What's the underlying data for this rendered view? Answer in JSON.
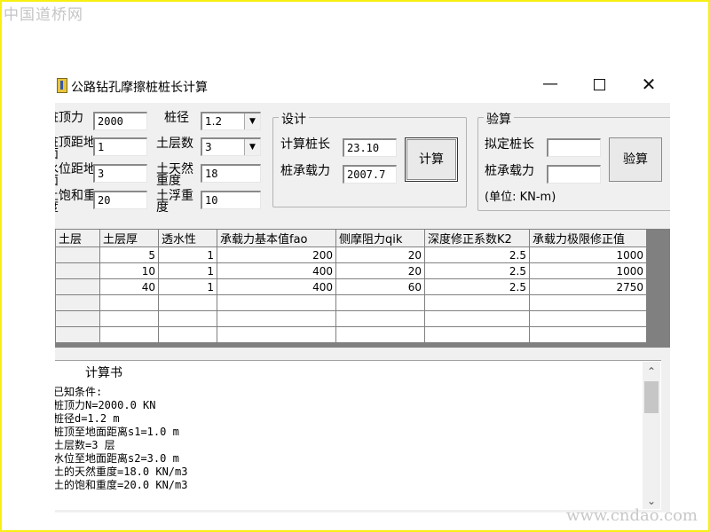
{
  "watermark_top": "中国道桥网",
  "watermark_bottom": "www.cndao.com",
  "window": {
    "title": "公路钻孔摩擦桩桩长计算",
    "minimize": "—",
    "close": "✕"
  },
  "inputs": {
    "pile_top_force_label": "桩顶力",
    "pile_top_force_value": "2000",
    "pile_top_distance_label": "桩顶距地面",
    "pile_top_distance_value": "1",
    "water_distance_label": "水位距地面",
    "water_distance_value": "3",
    "saturated_weight_label": "土饱和重度",
    "saturated_weight_value": "20",
    "diameter_label": "桩径",
    "diameter_value": "1.2",
    "layers_label": "土层数",
    "layers_value": "3",
    "natural_weight_label": "土天然重度",
    "natural_weight_value": "18",
    "buoyant_weight_label": "土浮重度",
    "buoyant_weight_value": "10"
  },
  "design": {
    "title": "设计",
    "calc_length_label": "计算桩长",
    "calc_length_value": "23.10",
    "capacity_label": "桩承载力",
    "capacity_value": "2007.7",
    "calc_button": "计算"
  },
  "check": {
    "title": "验算",
    "proposed_length_label": "拟定桩长",
    "proposed_length_value": "",
    "capacity_label": "桩承载力",
    "capacity_value": "",
    "unit_text": "(单位: KN-m)",
    "check_button": "验算"
  },
  "grid": {
    "columns": [
      "土层",
      "土层厚",
      "透水性",
      "承载力基本值fao",
      "侧摩阻力qik",
      "深度修正系数K2",
      "承载力极限修正值"
    ],
    "rows": [
      [
        "",
        "5",
        "1",
        "200",
        "20",
        "2.5",
        "1000"
      ],
      [
        "",
        "10",
        "1",
        "400",
        "20",
        "2.5",
        "1000"
      ],
      [
        "",
        "40",
        "1",
        "400",
        "60",
        "2.5",
        "2750"
      ],
      [
        "",
        "",
        "",
        "",
        "",
        "",
        ""
      ],
      [
        "",
        "",
        "",
        "",
        "",
        "",
        ""
      ],
      [
        "",
        "",
        "",
        "",
        "",
        "",
        ""
      ]
    ]
  },
  "report": {
    "title": "计算书",
    "lines": [
      "已知条件:",
      "桩顶力N=2000.0 KN",
      "桩径d=1.2 m",
      "桩顶至地面距离s1=1.0 m",
      "土层数=3 层",
      "水位至地面距离s2=3.0 m",
      "土的天然重度=18.0 KN/m3",
      "土的饱和重度=20.0 KN/m3"
    ]
  }
}
